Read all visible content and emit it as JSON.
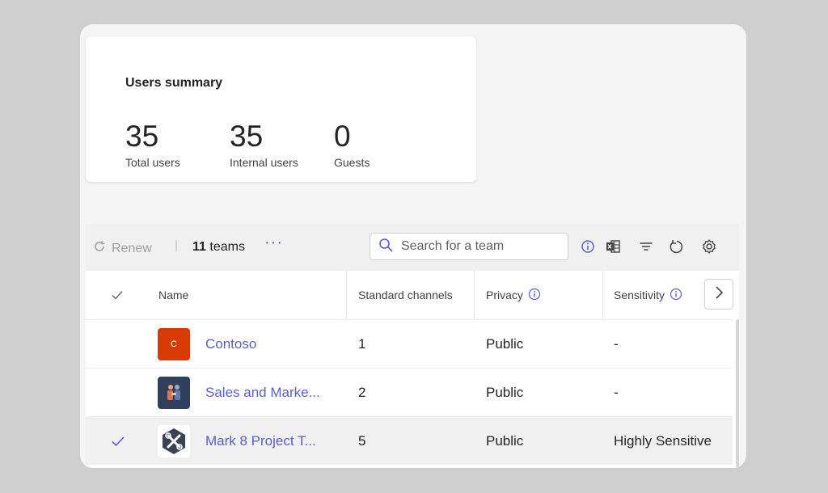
{
  "summary": {
    "title": "Users summary",
    "stats": [
      {
        "value": "35",
        "label": "Total users"
      },
      {
        "value": "35",
        "label": "Internal users"
      },
      {
        "value": "0",
        "label": "Guests"
      }
    ]
  },
  "toolbar": {
    "renew_label": "Renew",
    "separator": "|",
    "teams_count": "11",
    "teams_suffix": " teams",
    "more_label": "···",
    "search_placeholder": "Search for a team",
    "icons": [
      "info-icon",
      "excel-icon",
      "filter-icon",
      "refresh-icon",
      "settings-icon"
    ]
  },
  "table": {
    "columns": {
      "name": "Name",
      "channels": "Standard channels",
      "privacy": "Privacy",
      "sensitivity": "Sensitivity"
    },
    "rows": [
      {
        "icon_letter": "C",
        "icon_color": "#d83b01",
        "name": "Contoso",
        "channels": "1",
        "privacy": "Public",
        "sensitivity": "-",
        "selected": false
      },
      {
        "icon_letter": "",
        "icon_color": "#2f3f5c",
        "name": "Sales and Marke...",
        "channels": "2",
        "privacy": "Public",
        "sensitivity": "-",
        "selected": false
      },
      {
        "icon_letter": "",
        "icon_color": "#ffffff",
        "name": "Mark 8 Project T...",
        "channels": "5",
        "privacy": "Public",
        "sensitivity": "Highly Sensitive",
        "selected": true
      }
    ]
  },
  "colors": {
    "accent": "#5b5fc7",
    "contoso_tile": "#d83b01",
    "sales_tile": "#2f3f5c"
  }
}
